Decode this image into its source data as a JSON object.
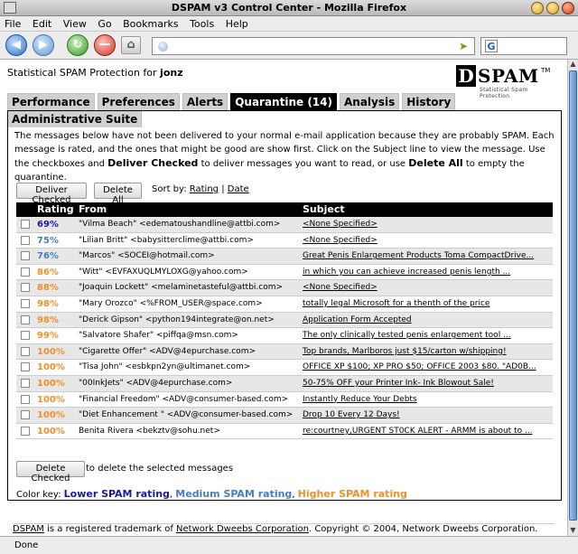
{
  "window": {
    "title": "DSPAM v3 Control Center - Mozilla Firefox"
  },
  "menu": {
    "items": [
      "File",
      "Edit",
      "View",
      "Go",
      "Bookmarks",
      "Tools",
      "Help"
    ]
  },
  "toolbar": {
    "url": "",
    "search": ""
  },
  "header": {
    "brand_prefix": "Statistical SPAM Protection for",
    "user": "jonz",
    "logo_letter": "D",
    "logo_rest": "SPAM",
    "logo_tm": "TM",
    "logo_tagline": "Statistical Spam Protection"
  },
  "tabs": [
    {
      "label": "Performance"
    },
    {
      "label": "Preferences"
    },
    {
      "label": "Alerts"
    },
    {
      "label": "Quarantine (14)",
      "active": true
    },
    {
      "label": "Analysis"
    },
    {
      "label": "History"
    },
    {
      "label": "Administrative Suite"
    }
  ],
  "intro": {
    "part1": "The messages below have not been delivered to your normal e-mail application because they are probably SPAM. Each message is rated, and the ones that might be good are show first. Click on the Subject line to view the message. Use the checkboxes and ",
    "bold1": "Deliver Checked",
    "part2": " to deliver messages you want to read, or use ",
    "bold2": "Delete All",
    "part3": " to empty the quarantine."
  },
  "actions": {
    "deliver_checked": "Deliver Checked",
    "delete_all": "Delete All",
    "sort_by": "Sort by:",
    "sort_rating": "Rating",
    "sort_sep": "|",
    "sort_date": "Date"
  },
  "table": {
    "headers": {
      "rating": "Rating",
      "from": "From",
      "subject": "Subject"
    },
    "rows": [
      {
        "rating": "69%",
        "color": "#1a1aa0",
        "from": "\"Vilma Beach\" <edematoushandline@attbi.com>",
        "subject": "<None Specified>"
      },
      {
        "rating": "75%",
        "color": "#4a7cc0",
        "from": "\"Lilian Britt\" <babysitterclime@attbi.com>",
        "subject": "<None Specified>"
      },
      {
        "rating": "76%",
        "color": "#4a7cc0",
        "from": "\"Marcos\" <SOCEI@hotmail.com>",
        "subject": "Great Penis Enlargement Products Toma CompactDrive..."
      },
      {
        "rating": "86%",
        "color": "#f0902a",
        "from": "\"Witt\" <EVFAXUQLMYLOXG@yahoo.com>",
        "subject": "in which you can achieve increased penis length ..."
      },
      {
        "rating": "88%",
        "color": "#f0902a",
        "from": "\"Joaquin Lockett\" <melaminetasteful@attbi.com>",
        "subject": "<None Specified>"
      },
      {
        "rating": "98%",
        "color": "#f0902a",
        "from": "\"Mary Orozco\" <%FROM_USER@space.com>",
        "subject": "totally legal Microsoft for a thenth of the price"
      },
      {
        "rating": "98%",
        "color": "#f0902a",
        "from": "\"Derick Gipson\" <python194integrate@on.net>",
        "subject": "Application Form Accepted"
      },
      {
        "rating": "99%",
        "color": "#f0902a",
        "from": "\"Salvatore Shafer\" <piffqa@msn.com>",
        "subject": "The only clinically tested penis enlargement tool ..."
      },
      {
        "rating": "100%",
        "color": "#f0902a",
        "from": "\"Cigarette Offer\" <ADV@4epurchase.com>",
        "subject": "Top brands, Marlboros just $15/carton w/shipping!"
      },
      {
        "rating": "100%",
        "color": "#f0902a",
        "from": "\"Tisa John\" <esbkpn2yn@ultimanet.com>",
        "subject": "OFFICE XP $100; XP PRO $50; OFFICE 2003 $80. \"AD0B..."
      },
      {
        "rating": "100%",
        "color": "#f0902a",
        "from": "\"00InkJets\" <ADV@4epurchase.com>",
        "subject": "50-75% OFF your Printer Ink- Ink Blowout Sale!"
      },
      {
        "rating": "100%",
        "color": "#f0902a",
        "from": "\"Financial Freedom\" <ADV@consumer-based.com>",
        "subject": "Instantly Reduce Your Debts"
      },
      {
        "rating": "100%",
        "color": "#f0902a",
        "from": "\"Diet Enhancement \" <ADV@consumer-based.com>",
        "subject": "Drop 10 Every 12 Days!"
      },
      {
        "rating": "100%",
        "color": "#f0902a",
        "from": "Benita Rivera <bekztv@sohu.net>",
        "subject": "re:courtney,URGENT ST0CK ALERT - ARMM is about to ..."
      }
    ]
  },
  "delete_checked": {
    "label": "Delete Checked",
    "text": "to delete the selected messages"
  },
  "colorkey": {
    "label": "Color key:",
    "low": "Lower SPAM rating",
    "medium": "Medium SPAM rating",
    "high": "Higher SPAM rating",
    "low_color": "#1a1aa0",
    "medium_color": "#4a7cc0",
    "high_color": "#f0902a"
  },
  "footer": {
    "dspam": "DSPAM",
    "text1": " is a registered trademark of ",
    "company": "Network Dweebs Corporation",
    "text2": ". Copyright © 2004, Network Dweebs Corporation."
  },
  "status": {
    "text": "Done"
  }
}
